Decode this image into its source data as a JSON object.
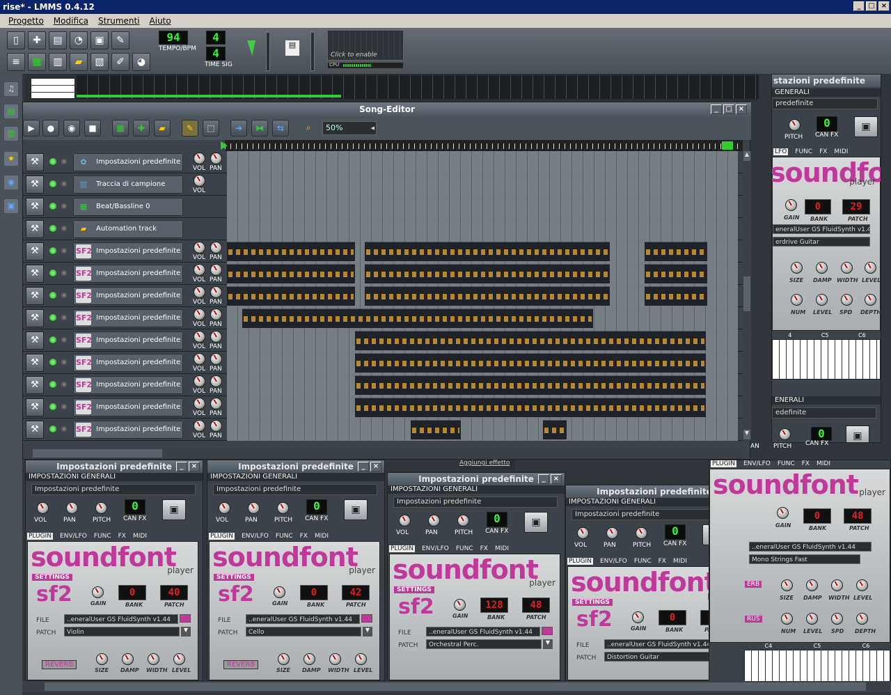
{
  "window": {
    "title": "rise* - LMMS 0.4.12"
  },
  "menu": [
    "Progetto",
    "Modifica",
    "Strumenti",
    "Aiuto"
  ],
  "toolbar": {
    "tempo_value": "94",
    "tempo_label": "TEMPO/BPM",
    "timesig_num": "4",
    "timesig_den": "4",
    "timesig_label": "TIME SIG",
    "click_enable": "Click to enable",
    "cpu_label": "CPU"
  },
  "song_editor": {
    "title": "Song-Editor",
    "zoom": "50%",
    "tracks": [
      {
        "name": "Impostazioni predefinite",
        "icon": "instrument-icon",
        "knobs": [
          "VOL",
          "PAN"
        ]
      },
      {
        "name": "Traccia di campione",
        "icon": "sample-track-icon",
        "knobs": [
          "VOL"
        ]
      },
      {
        "name": "Beat/Bassline 0",
        "icon": "beat-bassline-icon",
        "knobs": []
      },
      {
        "name": "Automation track",
        "icon": "automation-folder-icon",
        "knobs": []
      },
      {
        "name": "Impostazioni predefinite",
        "icon": "sf2-icon",
        "knobs": [
          "VOL",
          "PAN"
        ]
      },
      {
        "name": "Impostazioni predefinite",
        "icon": "sf2-icon",
        "knobs": [
          "VOL",
          "PAN"
        ]
      },
      {
        "name": "Impostazioni predefinite",
        "icon": "sf2-icon",
        "knobs": [
          "VOL",
          "PAN"
        ]
      },
      {
        "name": "Impostazioni predefinite",
        "icon": "sf2-icon",
        "knobs": [
          "VOL",
          "PAN"
        ]
      },
      {
        "name": "Impostazioni predefinite",
        "icon": "sf2-icon",
        "knobs": [
          "VOL",
          "PAN"
        ]
      },
      {
        "name": "Impostazioni predefinite",
        "icon": "sf2-icon",
        "knobs": [
          "VOL",
          "PAN"
        ]
      },
      {
        "name": "Impostazioni predefinite",
        "icon": "sf2-icon",
        "knobs": [
          "VOL",
          "PAN"
        ]
      },
      {
        "name": "Impostazioni predefinite",
        "icon": "sf2-icon",
        "knobs": [
          "VOL",
          "PAN"
        ]
      },
      {
        "name": "Impostazioni predefinite",
        "icon": "sf2-icon",
        "knobs": [
          "VOL",
          "PAN"
        ]
      }
    ]
  },
  "right_panel": {
    "title_top": "stazioni predefinite",
    "generali": "GENERALI",
    "name": "predefinite",
    "pitch_label": "PITCH",
    "canfx_label": "CAN FX",
    "canfx_value": "0",
    "tabs": [
      "LFO",
      "FUNC",
      "FX",
      "MIDI"
    ],
    "logo": "soundfont",
    "player": "player",
    "gain": "GAIN",
    "bank": "BANK",
    "patch": "PATCH",
    "bank_value": "0",
    "patch_value": "29",
    "file": "eneralUser GS FluidSynth v1.44",
    "patch_name": "erdrive Guitar",
    "knob_row1": [
      "SIZE",
      "DAMP",
      "WIDTH",
      "LEVEL"
    ],
    "knob_row2": [
      "NUM",
      "LEVEL",
      "SPD",
      "DEPTH"
    ],
    "octaves": [
      "4",
      "C5",
      "C6"
    ],
    "generali2": "ENERALI",
    "name2": "edefinite",
    "an": "AN",
    "pitch2": "PITCH",
    "canfx2": "CAN FX",
    "canfx2_value": "0"
  },
  "bottom_right": {
    "tabs": [
      "PLUGIN",
      "ENV/LFO",
      "FUNC",
      "FX",
      "MIDI"
    ],
    "logo": "soundfont",
    "player": "player",
    "gain": "GAIN",
    "bank": "BANK",
    "patch": "PATCH",
    "bank_value": "0",
    "patch_value": "48",
    "file": "..eneralUser GS FluidSynth v1.44",
    "patch_name": "Mono Strings Fast",
    "knob_row1": [
      "SIZE",
      "DAMP",
      "WIDTH",
      "LEVEL"
    ],
    "knob_row2": [
      "NUM",
      "LEVEL",
      "SPD",
      "DEPTH"
    ],
    "octaves": [
      "C4",
      "C5",
      "C6"
    ],
    "reverb": "ERB",
    "chorus": "RUS"
  },
  "aggiungi": "Aggiungi effetto",
  "instruments": [
    {
      "title": "Impostazioni predefinite",
      "head": "IMPOSTAZIONI GENERALI",
      "name": "Impostazioni predefinite",
      "knobs": [
        "VOL",
        "PAN",
        "PITCH"
      ],
      "canfx": "CAN FX",
      "canfx_value": "0",
      "tabs": [
        "PLUGIN",
        "ENV/LFO",
        "FUNC",
        "FX",
        "MIDI"
      ],
      "logo": "soundfont",
      "player": "player",
      "settings": "SETTINGS",
      "sf2": "sf2",
      "gain": "GAIN",
      "bank": "BANK",
      "patch": "PATCH",
      "bank_value": "0",
      "patch_value": "40",
      "file_label": "FILE",
      "file": "..eneralUser GS FluidSynth v1.44",
      "patch_label": "PATCH",
      "patch_name": "Violin",
      "reverb": "REVERB",
      "bottom_knobs": [
        "SIZE",
        "DAMP",
        "WIDTH",
        "LEVEL"
      ]
    },
    {
      "title": "Impostazioni predefinite",
      "head": "IMPOSTAZIONI GENERALI",
      "name": "Impostazioni predefinite",
      "knobs": [
        "VOL",
        "PAN",
        "PITCH"
      ],
      "canfx": "CAN FX",
      "canfx_value": "0",
      "tabs": [
        "PLUGIN",
        "ENV/LFO",
        "FUNC",
        "FX",
        "MIDI"
      ],
      "logo": "soundfont",
      "player": "player",
      "settings": "SETTINGS",
      "sf2": "sf2",
      "gain": "GAIN",
      "bank": "BANK",
      "patch": "PATCH",
      "bank_value": "0",
      "patch_value": "42",
      "file_label": "FILE",
      "file": "..eneralUser GS FluidSynth v1.44",
      "patch_label": "PATCH",
      "patch_name": "Cello",
      "reverb": "REVERB",
      "bottom_knobs": [
        "SIZE",
        "DAMP",
        "WIDTH",
        "LEVEL"
      ]
    },
    {
      "title": "Impostazioni predefinite",
      "head": "IMPOSTAZIONI GENERALI",
      "name": "Impostazioni predefinite",
      "knobs": [
        "VOL",
        "PAN",
        "PITCH"
      ],
      "canfx": "CAN FX",
      "canfx_value": "0",
      "tabs": [
        "PLUGIN",
        "ENV/LFO",
        "FUNC",
        "FX",
        "MIDI"
      ],
      "logo": "soundfont",
      "player": "player",
      "settings": "SETTINGS",
      "sf2": "sf2",
      "gain": "GAIN",
      "bank": "BANK",
      "patch": "PATCH",
      "bank_value": "128",
      "patch_value": "48",
      "file_label": "FILE",
      "file": "..eneralUser GS FluidSynth v1.44",
      "patch_label": "PATCH",
      "patch_name": "Orchestral Perc.",
      "reverb": "",
      "bottom_knobs": []
    },
    {
      "title": "Impostazioni predefinite",
      "head": "IMPOSTAZIONI GENERALI",
      "name": "Impostazioni predefinite",
      "knobs": [
        "VOL",
        "PAN",
        "PITCH"
      ],
      "canfx": "CAN FX",
      "canfx_value": "0",
      "tabs": [
        "PLUGIN",
        "ENV/LFO",
        "FUNC",
        "FX",
        "MIDI"
      ],
      "logo": "soundfont",
      "player": "player",
      "settings": "SETTINGS",
      "sf2": "sf2",
      "gain": "GAIN",
      "bank": "BANK",
      "patch": "PATCH",
      "bank_value": "0",
      "patch_value": "30",
      "file_label": "FILE",
      "file": "..eneralUser GS FluidSynth v1.44",
      "patch_label": "PATCH",
      "patch_name": "Distortion Guitar",
      "reverb": "",
      "bottom_knobs": []
    }
  ]
}
